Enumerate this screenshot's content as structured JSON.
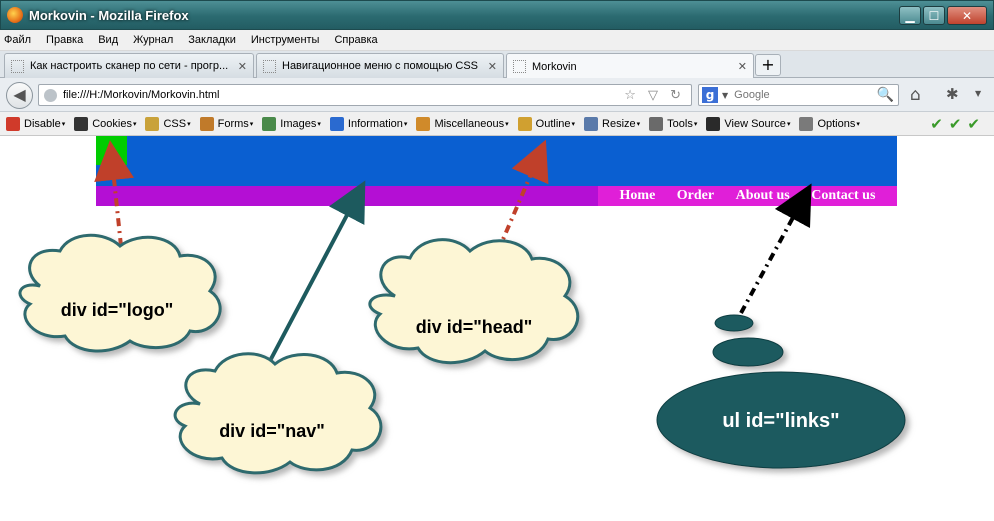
{
  "window": {
    "title": "Morkovin - Mozilla Firefox",
    "minimize_label": "▁",
    "maximize_label": "☐",
    "close_label": "✕"
  },
  "menubar": {
    "items": [
      "Файл",
      "Правка",
      "Вид",
      "Журнал",
      "Закладки",
      "Инструменты",
      "Справка"
    ]
  },
  "tabs": [
    {
      "label": "Как настроить сканер по сети - прогр...",
      "active": false
    },
    {
      "label": "Навигационное меню с помощью CSS",
      "active": false
    },
    {
      "label": "Morkovin",
      "active": true
    }
  ],
  "tab_close": "✕",
  "new_tab_label": "+",
  "navbar": {
    "back_icon": "◀",
    "url": "file:///H:/Morkovin/Morkovin.html",
    "url_icons": "☆ ▽ ↻",
    "search_engine": "g",
    "search_placeholder": "Google",
    "search_icon": "🔍",
    "home_icon": "⌂",
    "bug_icon": "✱",
    "menu_arrow": "▼"
  },
  "devbar": {
    "items": [
      {
        "label": "Disable",
        "icon_color": "#d03a2a"
      },
      {
        "label": "Cookies",
        "icon_color": "#333333"
      },
      {
        "label": "CSS",
        "icon_color": "#c9a23a"
      },
      {
        "label": "Forms",
        "icon_color": "#c07a2a"
      },
      {
        "label": "Images",
        "icon_color": "#4a8a4a"
      },
      {
        "label": "Information",
        "icon_color": "#2a6ad0"
      },
      {
        "label": "Miscellaneous",
        "icon_color": "#d08a2a"
      },
      {
        "label": "Outline",
        "icon_color": "#d0a030"
      },
      {
        "label": "Resize",
        "icon_color": "#5a7aaa"
      },
      {
        "label": "Tools",
        "icon_color": "#6a6a6a"
      },
      {
        "label": "View Source",
        "icon_color": "#2a2a2a"
      },
      {
        "label": "Options",
        "icon_color": "#7a7a7a"
      }
    ],
    "dropdown_glyph": "▾",
    "checks": "✔✔✔"
  },
  "page": {
    "links": [
      "Home",
      "Order",
      "About us",
      "Contact us"
    ]
  },
  "callouts": {
    "logo": "div id=\"logo\"",
    "nav": "div id=\"nav\"",
    "head": "div id=\"head\"",
    "links": "ul id=\"links\""
  },
  "colors": {
    "head": "#0a5fd1",
    "logo": "#00cc00",
    "nav": "#b40fd4",
    "links": "#e01fd8",
    "cloud_fill": "#fdf6d5",
    "cloud_stroke": "#2d6a6e",
    "ellipse_fill": "#1a5a5e"
  }
}
